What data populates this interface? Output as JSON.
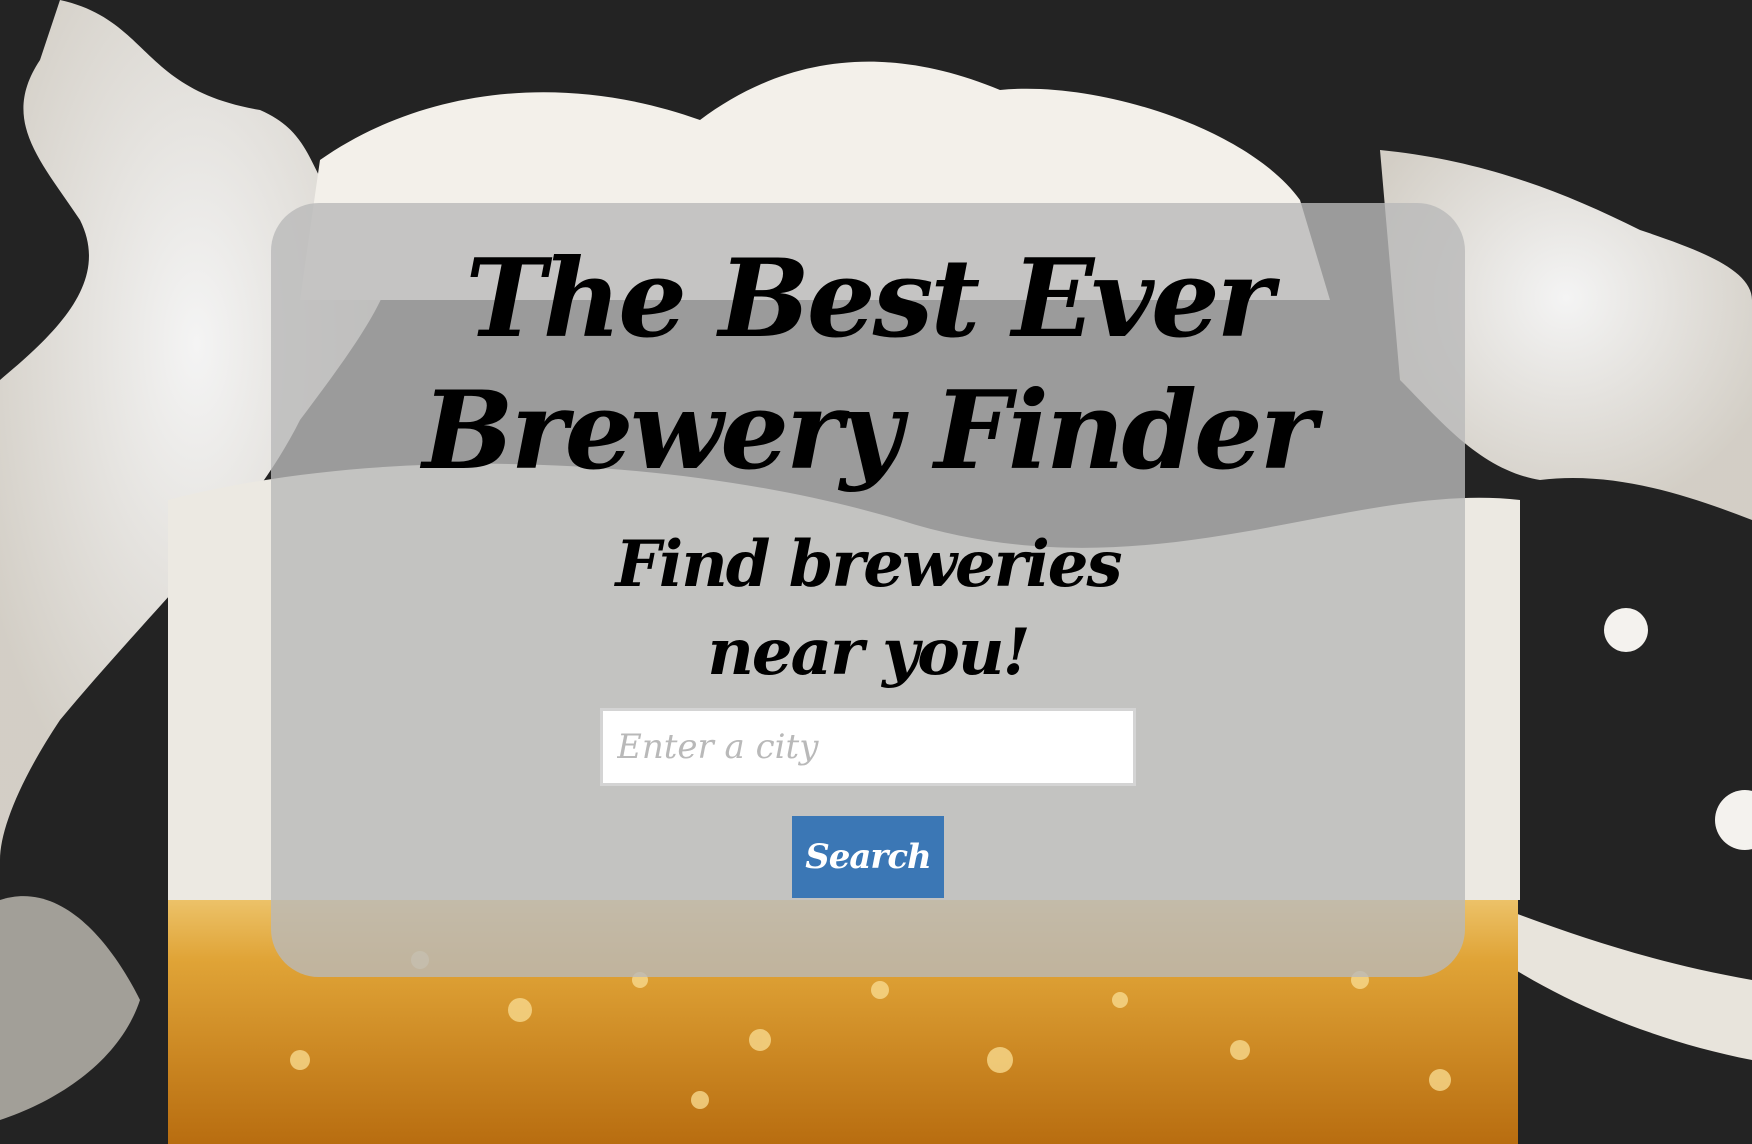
{
  "hero": {
    "title": "The Best Ever Brewery Finder",
    "subtitle": "Find breweries near you!"
  },
  "search": {
    "placeholder": "Enter a city",
    "value": "",
    "button_label": "Search"
  },
  "colors": {
    "background_dark": "#222222",
    "foam": "#f2efe9",
    "beer": "#d89a2c",
    "card_overlay": "#b9b9b9",
    "button": "#3b77b5"
  },
  "background_image": "beer-splash-image"
}
